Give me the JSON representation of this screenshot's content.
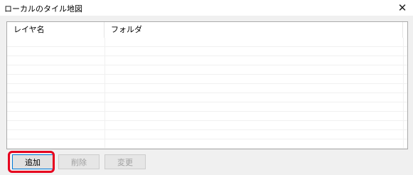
{
  "window": {
    "title": "ローカルのタイル地図",
    "close_glyph": "✕"
  },
  "list": {
    "columns": [
      "レイヤ名",
      "フォルダ"
    ],
    "rows": []
  },
  "buttons": {
    "add": "追加",
    "delete": "削除",
    "change": "変更"
  },
  "colors": {
    "highlight": "#e6001e",
    "focus_border": "#0078d7"
  }
}
